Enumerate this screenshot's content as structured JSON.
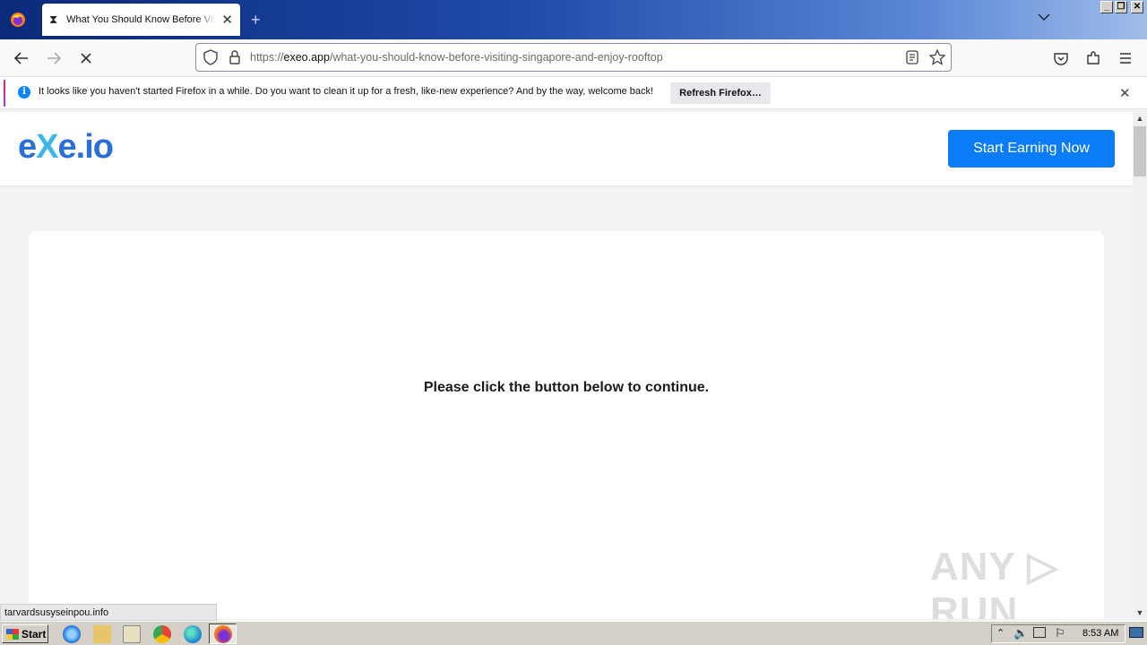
{
  "browser": {
    "tab_title": "What You Should Know Before Visiting Singapore and Enjoy Rooftop",
    "url_scheme": "https://",
    "url_host": "exeo.app",
    "url_path": "/what-you-should-know-before-visiting-singapore-and-enjoy-rooftop",
    "new_tab_symbol": "+"
  },
  "notification": {
    "message": "It looks like you haven't started Firefox in a while. Do you want to clean it up for a fresh, like-new experience? And by the way, welcome back!",
    "button_label": "Refresh Firefox…",
    "info_symbol": "i"
  },
  "site": {
    "logo_e": "e",
    "logo_x": "X",
    "logo_rest": "e.io",
    "cta_label": "Start Earning Now",
    "card_message": "Please click the button below to continue."
  },
  "watermark": "ANY ▷ RUN",
  "status_link": "tarvardsusyseinpou.info",
  "taskbar": {
    "start_label": "Start",
    "clock": "8:53 AM"
  },
  "colors": {
    "accent": "#0b7cf7",
    "logo_blue": "#2b6fd6",
    "logo_cyan": "#3db6e8"
  }
}
